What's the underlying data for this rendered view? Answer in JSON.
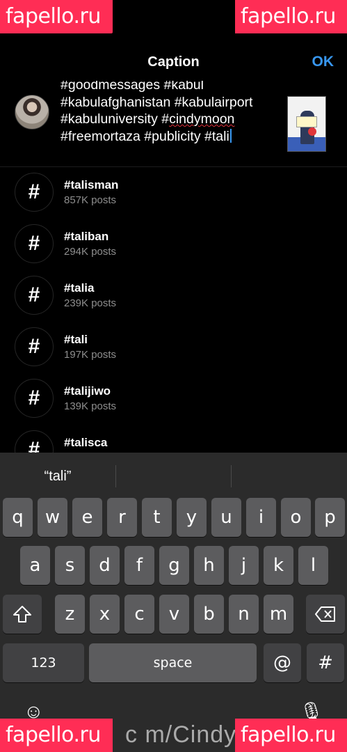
{
  "watermarks": [
    "fapello.ru",
    "fapello.ru",
    "fapello.ru",
    "fapello.ru"
  ],
  "nav": {
    "title": "Caption",
    "ok_label": "OK"
  },
  "caption": {
    "text_before": "#goodmessages #kabul\n#kabulafghanistan #kabulairport\n#kabuluniversity #",
    "misspelled": "cindymoon",
    "text_after": "\n#freemortaza #publicity #tali"
  },
  "suggestions": [
    {
      "tag": "#talisman",
      "count": "857K posts"
    },
    {
      "tag": "#taliban",
      "count": "294K posts"
    },
    {
      "tag": "#talia",
      "count": "239K posts"
    },
    {
      "tag": "#tali",
      "count": "197K posts"
    },
    {
      "tag": "#talijiwo",
      "count": "139K posts"
    },
    {
      "tag": "#talisca",
      "count": ""
    }
  ],
  "keyboard": {
    "prediction": "“tali”",
    "row1": [
      "q",
      "w",
      "e",
      "r",
      "t",
      "y",
      "u",
      "i",
      "o",
      "p"
    ],
    "row2": [
      "a",
      "s",
      "d",
      "f",
      "g",
      "h",
      "j",
      "k",
      "l"
    ],
    "row3": [
      "z",
      "x",
      "c",
      "v",
      "b",
      "n",
      "m"
    ],
    "numbers_key": "123",
    "space_key": "space",
    "at_key": "@",
    "hash_key": "#"
  },
  "bottom_url": "c m/Cindy"
}
